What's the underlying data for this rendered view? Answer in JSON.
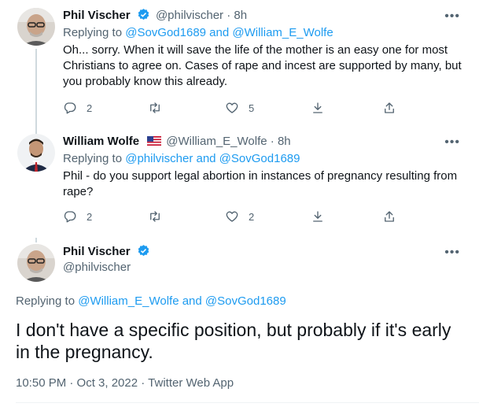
{
  "tweets": [
    {
      "name": "Phil Vischer",
      "handle": "@philvischer",
      "time": "8h",
      "verified": true,
      "replying_prefix": "Replying to ",
      "replying_to": "@SovGod1689 and @William_E_Wolfe",
      "text": "Oh... sorry.  When it will save the life of the mother is an easy one for most Christians to agree on.  Cases of rape and incest are supported by many, but you probably  know this already.",
      "reply_count": "2",
      "like_count": "5"
    },
    {
      "name": "William Wolfe",
      "handle": "@William_E_Wolfe",
      "time": "8h",
      "flag": "us-flag",
      "replying_prefix": "Replying to ",
      "replying_to": "@philvischer and @SovGod1689",
      "text": "Phil - do you support legal abortion in instances of pregnancy resulting from rape?",
      "reply_count": "2",
      "like_count": "2"
    }
  ],
  "main_tweet": {
    "name": "Phil Vischer",
    "handle": "@philvischer",
    "verified": true,
    "replying_prefix": "Replying to ",
    "replying_to": "@William_E_Wolfe and @SovGod1689",
    "text": "I don't have a specific position, but probably if it's early in the pregnancy.",
    "timestamp": "10:50 PM · Oct 3, 2022 · ",
    "source": "Twitter Web App"
  },
  "more_label": "•••",
  "separator": " · ",
  "colors": {
    "accent": "#1d9bf0",
    "muted": "#536471",
    "line": "#cfd9de"
  }
}
